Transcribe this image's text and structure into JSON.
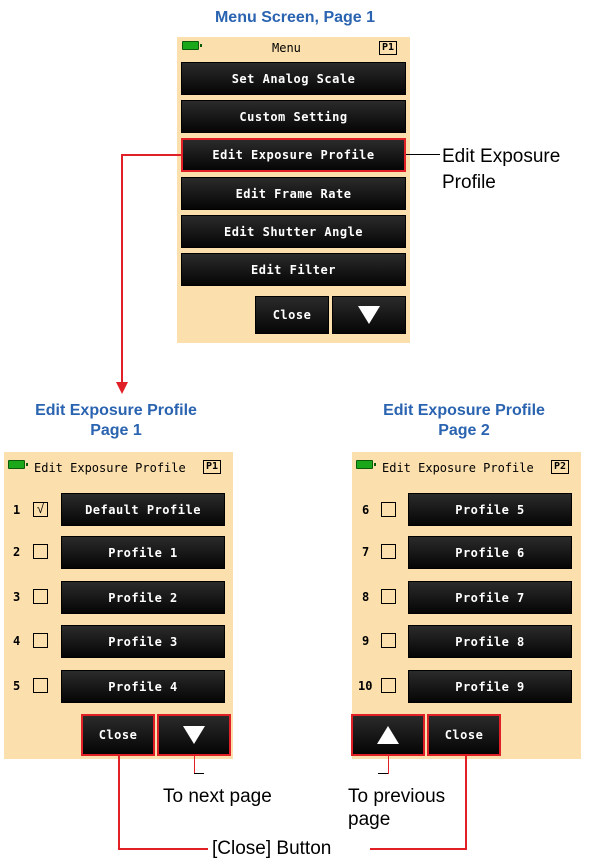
{
  "menu": {
    "caption": "Menu Screen, Page 1",
    "title": "Menu",
    "page": "P1",
    "items": [
      "Set Analog Scale",
      "Custom Setting",
      "Edit Exposure Profile",
      "Edit Frame Rate",
      "Edit Shutter Angle",
      "Edit Filter"
    ],
    "close": "Close",
    "annotation": "Edit Exposure Profile"
  },
  "edit1": {
    "caption_line1": "Edit Exposure Profile",
    "caption_line2": "Page 1",
    "title": "Edit Exposure Profile",
    "page": "P1",
    "rows": [
      {
        "num": "1",
        "label": "Default Profile",
        "checked": "√"
      },
      {
        "num": "2",
        "label": "Profile 1",
        "checked": ""
      },
      {
        "num": "3",
        "label": "Profile 2",
        "checked": ""
      },
      {
        "num": "4",
        "label": "Profile 3",
        "checked": ""
      },
      {
        "num": "5",
        "label": "Profile 4",
        "checked": ""
      }
    ],
    "close": "Close"
  },
  "edit2": {
    "caption_line1": "Edit Exposure Profile",
    "caption_line2": "Page 2",
    "title": "Edit Exposure Profile",
    "page": "P2",
    "rows": [
      {
        "num": "6",
        "label": "Profile 5",
        "checked": ""
      },
      {
        "num": "7",
        "label": "Profile 6",
        "checked": ""
      },
      {
        "num": "8",
        "label": "Profile 7",
        "checked": ""
      },
      {
        "num": "9",
        "label": "Profile 8",
        "checked": ""
      },
      {
        "num": "10",
        "label": "Profile 9",
        "checked": ""
      }
    ],
    "close": "Close"
  },
  "notes": {
    "next_page": "To next page",
    "prev_page_1": "To previous",
    "prev_page_2": "page",
    "close_button": "[Close] Button"
  },
  "colors": {
    "caption": "#2a63b0",
    "screen": "#fbe0ae",
    "highlight": "#e01f26",
    "battery": "#1aa81a"
  }
}
